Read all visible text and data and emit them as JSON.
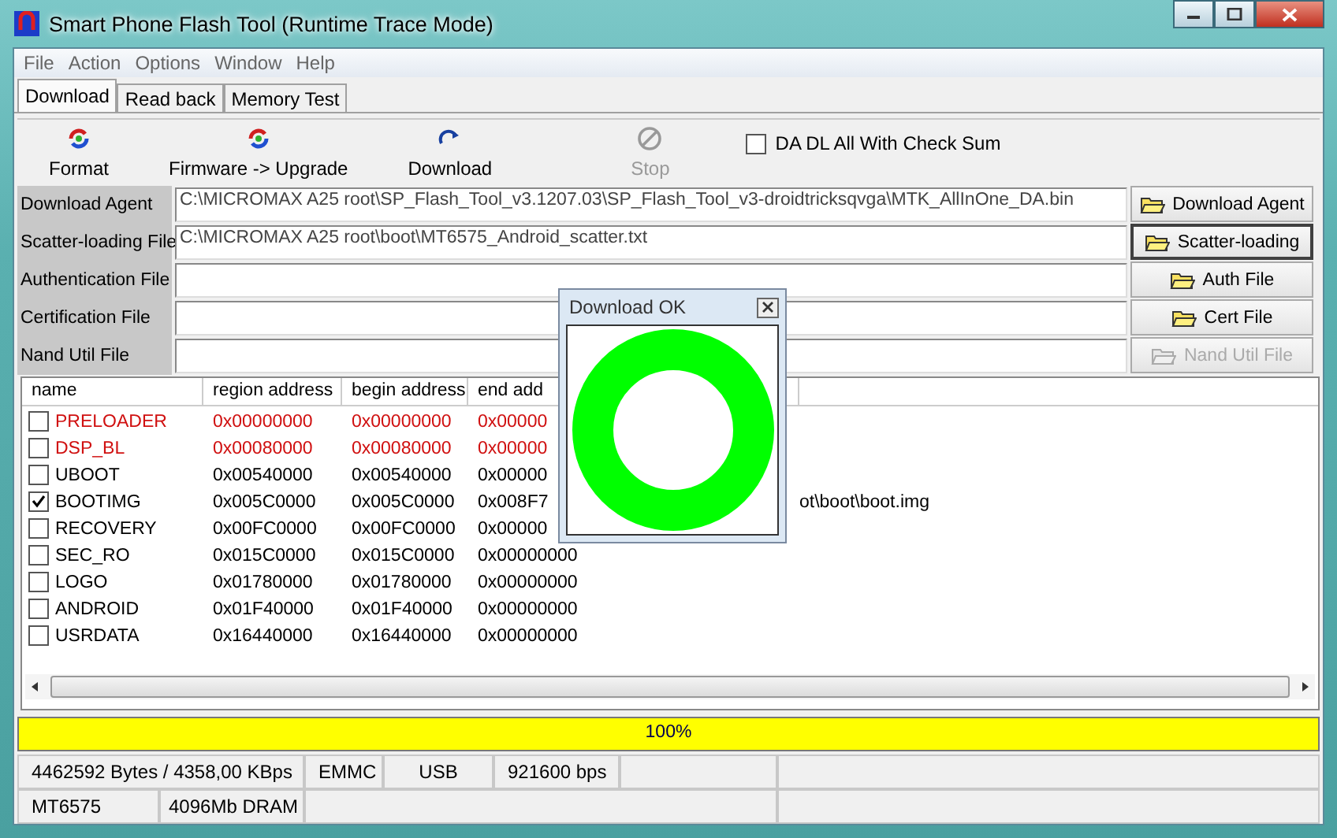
{
  "window": {
    "title": "Smart Phone Flash Tool (Runtime Trace Mode)"
  },
  "menu": [
    "File",
    "Action",
    "Options",
    "Window",
    "Help"
  ],
  "tabs": [
    {
      "label": "Download",
      "selected": true
    },
    {
      "label": "Read back",
      "selected": false
    },
    {
      "label": "Memory Test",
      "selected": false
    }
  ],
  "toolbar": [
    {
      "kind": "format",
      "label": "Format",
      "disabled": false
    },
    {
      "kind": "upgrade",
      "label": "Firmware -> Upgrade",
      "disabled": false
    },
    {
      "kind": "download",
      "label": "Download",
      "disabled": false
    },
    {
      "kind": "stop",
      "label": "Stop",
      "disabled": true
    }
  ],
  "checksum": {
    "label": "DA DL All With Check Sum",
    "checked": false
  },
  "files": [
    {
      "label": "Download Agent",
      "value": "C:\\MICROMAX A25 root\\SP_Flash_Tool_v3.1207.03\\SP_Flash_Tool_v3-droidtricksqvga\\MTK_AllInOne_DA.bin",
      "button": "Download Agent",
      "disabled": false,
      "selected": false
    },
    {
      "label": "Scatter-loading File",
      "value": "C:\\MICROMAX A25 root\\boot\\MT6575_Android_scatter.txt",
      "button": "Scatter-loading",
      "disabled": false,
      "selected": true
    },
    {
      "label": "Authentication File",
      "button": "Auth File",
      "disabled": false,
      "selected": false
    },
    {
      "label": "Certification File",
      "button": "Cert File",
      "disabled": false,
      "selected": false
    },
    {
      "label": "Nand Util File",
      "button": "Nand Util File",
      "disabled": true,
      "selected": false
    }
  ],
  "table": {
    "columns": [
      "name",
      "region address",
      "begin address",
      "end add"
    ],
    "rows": [
      {
        "name": "PRELOADER",
        "region": "0x00000000",
        "begin": "0x00000000",
        "end": "0x00000",
        "checked": false,
        "error": true
      },
      {
        "name": "DSP_BL",
        "region": "0x00080000",
        "begin": "0x00080000",
        "end": "0x00000",
        "checked": false,
        "error": true
      },
      {
        "name": "UBOOT",
        "region": "0x00540000",
        "begin": "0x00540000",
        "end": "0x00000",
        "checked": false,
        "error": false
      },
      {
        "name": "BOOTIMG",
        "region": "0x005C0000",
        "begin": "0x005C0000",
        "end": "0x008F7",
        "location": "ot\\boot\\boot.img",
        "checked": true,
        "error": false
      },
      {
        "name": "RECOVERY",
        "region": "0x00FC0000",
        "begin": "0x00FC0000",
        "end": "0x00000",
        "checked": false,
        "error": false
      },
      {
        "name": "SEC_RO",
        "region": "0x015C0000",
        "begin": "0x015C0000",
        "end": "0x00000000",
        "checked": false,
        "error": false
      },
      {
        "name": "LOGO",
        "region": "0x01780000",
        "begin": "0x01780000",
        "end": "0x00000000",
        "checked": false,
        "error": false
      },
      {
        "name": "ANDROID",
        "region": "0x01F40000",
        "begin": "0x01F40000",
        "end": "0x00000000",
        "checked": false,
        "error": false
      },
      {
        "name": "USRDATA",
        "region": "0x16440000",
        "begin": "0x16440000",
        "end": "0x00000000",
        "checked": false,
        "error": false
      }
    ]
  },
  "progress": {
    "level": 1,
    "text": "100%"
  },
  "status_bar": {
    "row_1": [
      "4462592 Bytes / 4358,00 KBps",
      "EMMC",
      "USB",
      "921600 bps"
    ],
    "row_2": [
      "MT6575",
      "4096Mb DRAM"
    ]
  },
  "dialog": {
    "title": "Download OK"
  }
}
